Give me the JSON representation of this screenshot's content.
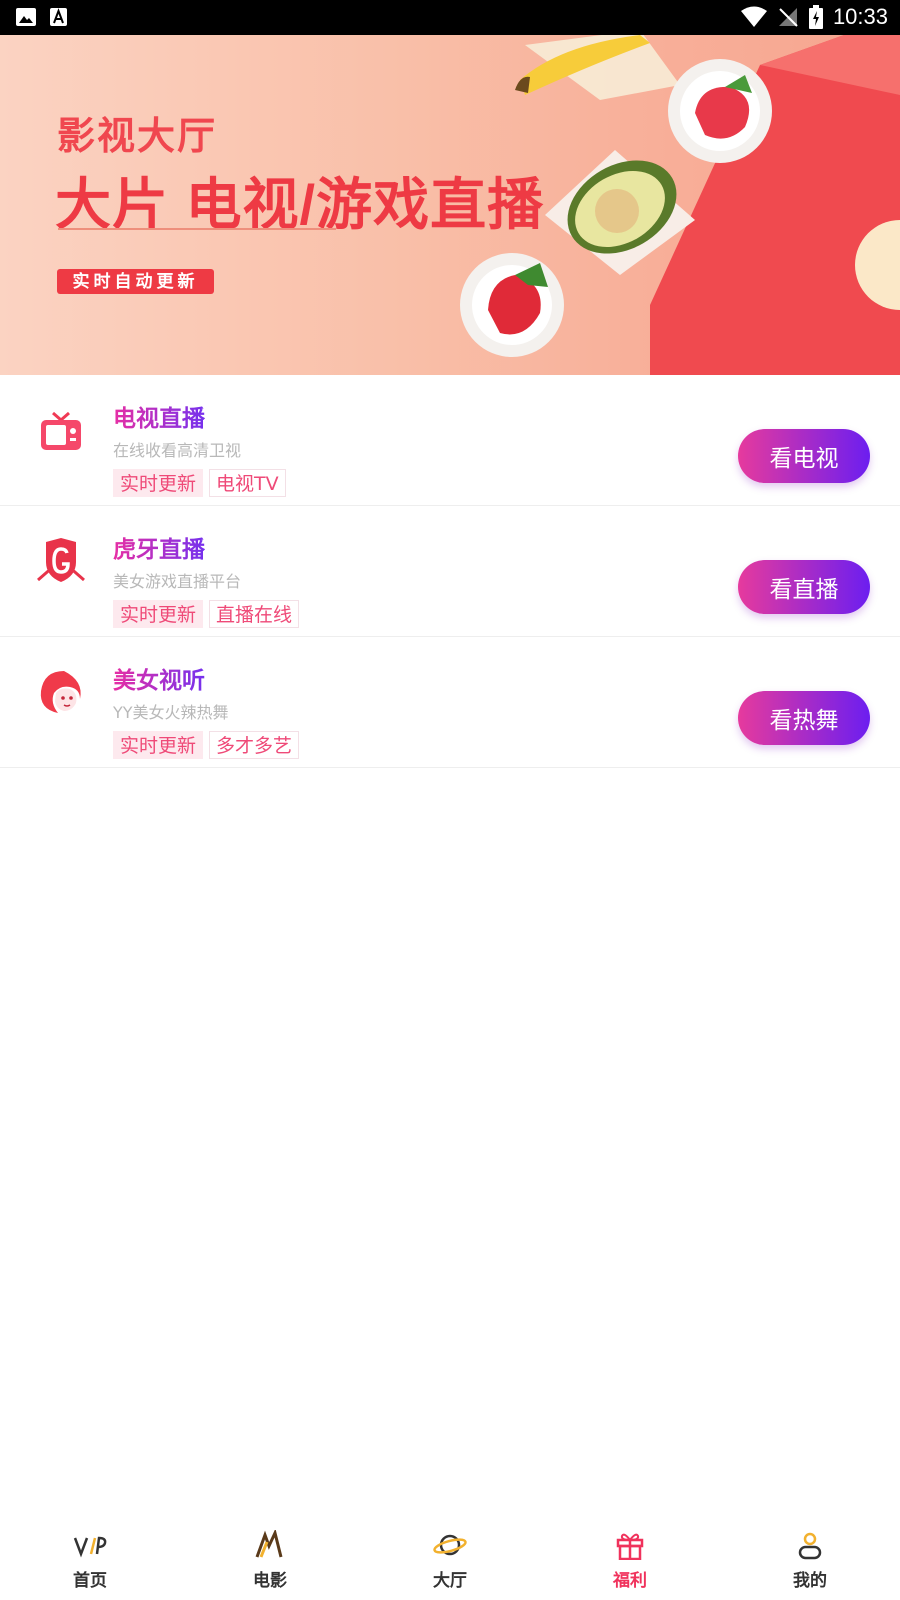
{
  "status_bar": {
    "time": "10:33",
    "icons": [
      "image-icon",
      "a-font-icon",
      "wifi-icon",
      "no-sim-icon",
      "battery-icon"
    ]
  },
  "banner": {
    "title_small": "影视大厅",
    "title_big": "大片 电视/游戏直播",
    "badge": "实时自动更新"
  },
  "list": [
    {
      "icon": "tv-icon",
      "title": "电视直播",
      "subtitle": "在线收看高清卫视",
      "tags": [
        "实时更新",
        "电视TV"
      ],
      "button": "看电视"
    },
    {
      "icon": "huya-shield-icon",
      "title": "虎牙直播",
      "subtitle": "美女游戏直播平台",
      "tags": [
        "实时更新",
        "直播在线"
      ],
      "button": "看直播"
    },
    {
      "icon": "girl-face-icon",
      "title": "美女视听",
      "subtitle": "YY美女火辣热舞",
      "tags": [
        "实时更新",
        "多才多艺"
      ],
      "button": "看热舞"
    }
  ],
  "bottom_nav": {
    "items": [
      {
        "label": "首页",
        "icon": "vip-icon"
      },
      {
        "label": "电影",
        "icon": "movie-icon"
      },
      {
        "label": "大厅",
        "icon": "planet-icon"
      },
      {
        "label": "福利",
        "icon": "gift-icon",
        "active": true
      },
      {
        "label": "我的",
        "icon": "user-icon"
      }
    ]
  },
  "colors": {
    "accent_red": "#ee3a44",
    "gradient_start": "#e63a9d",
    "gradient_end": "#6c1ef0",
    "tag_text": "#ef4a78",
    "nav_active": "#f0325c"
  }
}
